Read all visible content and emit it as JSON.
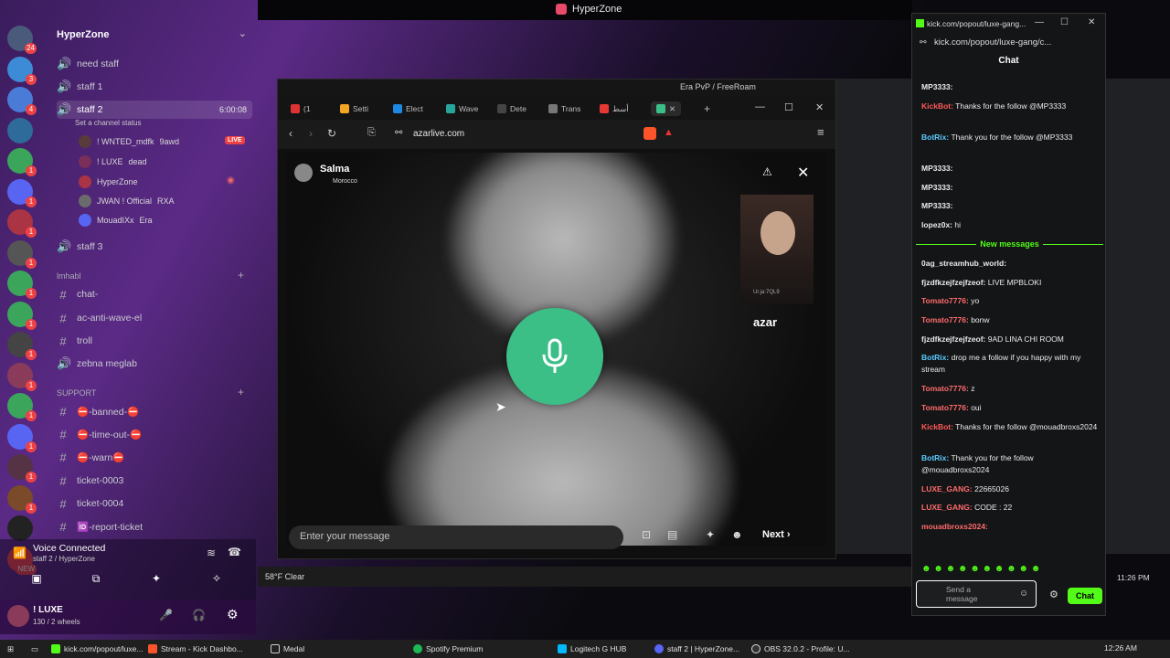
{
  "window": {
    "title": "HyperZone"
  },
  "servers": [
    {
      "icon": "discord-icon",
      "badge": "24"
    },
    {
      "icon": "discord-icon",
      "badge": "3"
    },
    {
      "icon": "globe-icon",
      "badge": "4"
    },
    {
      "icon": "tool-icon",
      "badge": ""
    },
    {
      "icon": "controller-icon",
      "badge": "1"
    },
    {
      "icon": "discord-icon",
      "badge": "1"
    },
    {
      "icon": "avatar-icon",
      "badge": "1"
    },
    {
      "icon": "avatar-icon",
      "badge": "1"
    },
    {
      "icon": "controller-icon",
      "badge": "1"
    },
    {
      "icon": "controller-icon",
      "badge": "1"
    },
    {
      "icon": "avatar-icon",
      "badge": "1"
    },
    {
      "icon": "avatar-icon",
      "badge": "1"
    },
    {
      "icon": "controller-icon",
      "badge": "1"
    },
    {
      "icon": "discord-icon",
      "badge": "1"
    },
    {
      "icon": "avatar-icon",
      "badge": "1"
    },
    {
      "icon": "avatar-icon",
      "badge": "1"
    },
    {
      "icon": "avatar-icon",
      "badge": ""
    },
    {
      "icon": "new-icon",
      "badge": "NEW"
    }
  ],
  "channels": {
    "server_name": "HyperZone",
    "voice": [
      {
        "name": "need staff"
      },
      {
        "name": "staff 1"
      },
      {
        "name": "staff 2",
        "time": "6:00:08",
        "status": "Set a channel status"
      },
      {
        "name": "staff 3"
      }
    ],
    "users": [
      {
        "name": "! WNTED_mdfk",
        "tag": "9awd",
        "live": "LIVE"
      },
      {
        "name": "! LUXE",
        "tag": "dead"
      },
      {
        "name": "HyperZone",
        "tag": ""
      },
      {
        "name": "JWAN ! Official",
        "tag": "RXA"
      },
      {
        "name": "MouadIXx",
        "tag": "Era"
      }
    ],
    "category1": "lmhabl",
    "text1": [
      {
        "name": "chat-"
      },
      {
        "name": "ac-anti-wave-el"
      },
      {
        "name": "troll"
      },
      {
        "name": "zebna meglab"
      }
    ],
    "category2": "SUPPORT",
    "text2": [
      {
        "name": "⛔-banned-⛔"
      },
      {
        "name": "⛔-time-out-⛔"
      },
      {
        "name": "⛔-warn⛔"
      },
      {
        "name": "ticket-0003"
      },
      {
        "name": "ticket-0004"
      },
      {
        "name": "🆔-report-ticket"
      }
    ]
  },
  "voice_panel": {
    "status": "Voice Connected",
    "sub": "staff 2 / HyperZone"
  },
  "user_panel": {
    "name": "! LUXE",
    "sub": "130 / 2 wheels"
  },
  "browser": {
    "window_title": "Era PvP / FreeRoam",
    "tabs": [
      "(1",
      "Setti",
      "Elect",
      "Wave",
      "Dete",
      "Trans",
      "أسط"
    ],
    "url": "azarlive.com",
    "profile_name": "Salma",
    "profile_country": "Morocco",
    "pip_label": "Ur.ja:7QL9",
    "logo": "azar",
    "message_placeholder": "Enter your message",
    "next_label": "Next"
  },
  "chat": {
    "tab_title": "kick.com/popout/luxe-gang...",
    "url": "kick.com/popout/luxe-gang/c...",
    "header": "Chat",
    "messages": [
      {
        "user": "MP3333:",
        "text": "",
        "color": "#ffffff"
      },
      {
        "user": "KickBot:",
        "text": "Thanks for the follow @MP3333",
        "color": "#ff5a5a"
      },
      {
        "user": "BotRix:",
        "text": "Thank you for the follow @MP3333",
        "color": "#5acbff"
      },
      {
        "user": "MP3333:",
        "text": "",
        "color": "#ffffff"
      },
      {
        "user": "MP3333:",
        "text": "",
        "color": "#ffffff"
      },
      {
        "user": "MP3333:",
        "text": "",
        "color": "#ffffff"
      },
      {
        "user": "lopez0x:",
        "text": "hi",
        "color": "#ffffff"
      }
    ],
    "new_messages_label": "New messages",
    "new_messages": [
      {
        "user": "0ag_streamhub_world:",
        "text": "",
        "color": "#ffffff"
      },
      {
        "user": "fjzdfkzejfzejfzeof:",
        "text": "LIVE MPBLOKI",
        "color": "#ffffff"
      },
      {
        "user": "Tomato7776:",
        "text": "yo",
        "color": "#ff6b6b"
      },
      {
        "user": "Tomato7776:",
        "text": "bonw",
        "color": "#ff6b6b"
      },
      {
        "user": "fjzdfkzejfzejfzeof:",
        "text": "9AD LINA CHI ROOM",
        "color": "#ffffff"
      },
      {
        "user": "BotRix:",
        "text": "drop me a follow if you happy with my stream",
        "color": "#5acbff"
      },
      {
        "user": "Tomato7776:",
        "text": "z",
        "color": "#ff6b6b"
      },
      {
        "user": "Tomato7776:",
        "text": "oui",
        "color": "#ff6b6b"
      },
      {
        "user": "KickBot:",
        "text": "Thanks for the follow @mouadbroxs2024",
        "color": "#ff5a5a"
      },
      {
        "user": "BotRix:",
        "text": "Thank you for the follow @mouadbroxs2024",
        "color": "#5acbff"
      },
      {
        "user": "LUXE_GANG:",
        "text": "22665026",
        "color": "#ff6b6b"
      },
      {
        "user": "LUXE_GANG:",
        "text": "CODE : 22",
        "color": "#ff6b6b"
      },
      {
        "user": "mouadbroxs2024:",
        "text": "",
        "color": "#ff6b6b"
      }
    ],
    "input_placeholder": "Send a message",
    "send_label": "Chat"
  },
  "system": {
    "weather": "58°F Clear",
    "clock_secondary": "11:26 PM",
    "clock": "12:26 AM",
    "taskbar": [
      {
        "label": "kick.com/popout/luxe...",
        "color": "#53fc18"
      },
      {
        "label": "Stream - Kick Dashbo...",
        "color": "#fb542b"
      },
      {
        "label": "Medal",
        "color": "#ffffff"
      },
      {
        "label": "Spotify Premium",
        "color": "#1db954"
      },
      {
        "label": "Logitech G HUB",
        "color": "#00b8fc"
      },
      {
        "label": "staff 2 | HyperZone...",
        "color": "#5865f2"
      },
      {
        "label": "OBS 32.0.2 - Profile: U...",
        "color": "#ffffff"
      }
    ]
  },
  "colors": {
    "kick_green": "#53fc18",
    "azar_green": "#3bbf87",
    "discord_red": "#ed4245"
  }
}
